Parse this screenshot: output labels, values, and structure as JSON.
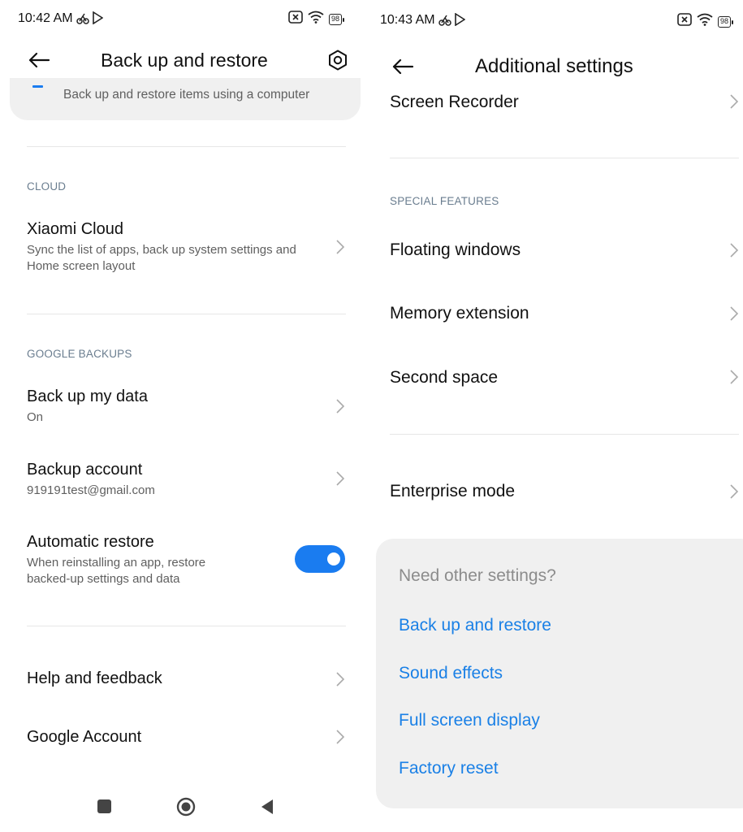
{
  "left": {
    "status": {
      "time": "10:42 AM",
      "battery": "98"
    },
    "header": {
      "title": "Back up and restore"
    },
    "computer_backup": {
      "subtitle": "Back up and restore items using a computer"
    },
    "cloud_section": {
      "label": "CLOUD",
      "xiaomi_cloud": {
        "title": "Xiaomi Cloud",
        "subtitle": "Sync the list of apps, back up system settings and Home screen layout"
      }
    },
    "google_section": {
      "label": "GOOGLE BACKUPS",
      "backup_data": {
        "title": "Back up my data",
        "subtitle": "On"
      },
      "backup_account": {
        "title": "Backup account",
        "subtitle": "919191test@gmail.com"
      },
      "auto_restore": {
        "title": "Automatic restore",
        "subtitle": "When reinstalling an app, restore backed-up settings and data",
        "enabled": true
      }
    },
    "help": {
      "title": "Help and feedback"
    },
    "google_account": {
      "title": "Google Account"
    },
    "nav": {
      "icons": [
        "recents-square-icon",
        "home-circle-icon",
        "back-triangle-icon"
      ]
    }
  },
  "right": {
    "status": {
      "time": "10:43 AM",
      "battery": "98"
    },
    "header": {
      "title": "Additional settings"
    },
    "screen_recorder": {
      "title": "Screen Recorder"
    },
    "special_section": {
      "label": "SPECIAL FEATURES",
      "floating": {
        "title": "Floating windows"
      },
      "memory": {
        "title": "Memory extension"
      },
      "second_space": {
        "title": "Second space"
      }
    },
    "enterprise": {
      "title": "Enterprise mode"
    },
    "other_settings": {
      "hint": "Need other settings?",
      "links": [
        "Back up and restore",
        "Sound effects",
        "Full screen display",
        "Factory reset"
      ]
    }
  },
  "colors": {
    "accent": "#1a7cf0",
    "link": "#1a80e6",
    "section_label": "#6a7d8f",
    "card_bg": "#f0f0f0"
  }
}
